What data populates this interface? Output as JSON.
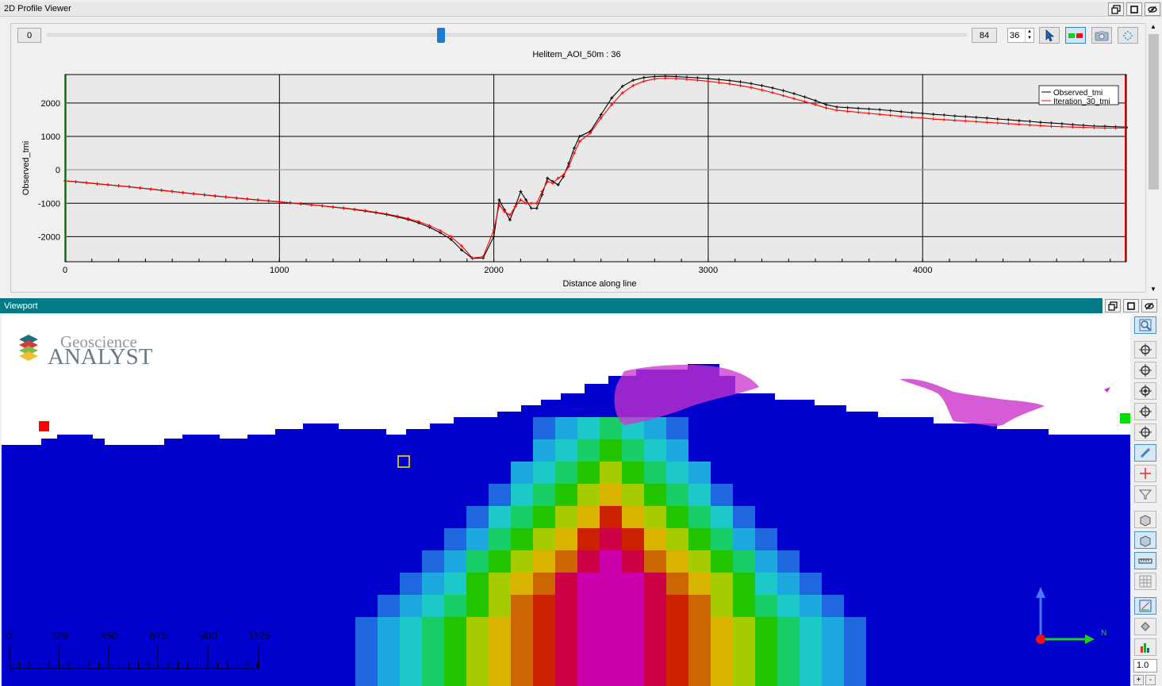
{
  "profile_viewer": {
    "title": "2D Profile Viewer",
    "slider": {
      "min_label": "0",
      "max_label": "84",
      "position": 0.4286
    },
    "station_value": "36",
    "tools": [
      "select-arrow-icon",
      "color-legend-icon",
      "camera-icon",
      "scatter-icon"
    ]
  },
  "chart_data": {
    "type": "line",
    "title": "Helitem_AOI_50m : 36",
    "xlabel": "Distance along line",
    "ylabel": "Observed_tmi",
    "xlim": [
      0,
      4950
    ],
    "ylim": [
      -2750,
      2850
    ],
    "xticks": [
      0,
      1000,
      2000,
      3000,
      4000
    ],
    "yticks": [
      -2000,
      -1000,
      0,
      1000,
      2000
    ],
    "x_grid_lines": [
      1000,
      2000,
      3000,
      4000
    ],
    "y_grid_lines": [
      -2000,
      -1000,
      0,
      1000,
      2000
    ],
    "legend_position": "top-right",
    "series": [
      {
        "name": "Observed_tmi",
        "color": "#000000",
        "marker": "+",
        "x": [
          0,
          50,
          100,
          150,
          200,
          250,
          300,
          350,
          400,
          450,
          500,
          550,
          600,
          650,
          700,
          750,
          800,
          850,
          900,
          950,
          1000,
          1050,
          1100,
          1150,
          1200,
          1250,
          1300,
          1350,
          1400,
          1450,
          1500,
          1550,
          1600,
          1650,
          1700,
          1750,
          1800,
          1850,
          1900,
          1950,
          2000,
          2025,
          2050,
          2075,
          2100,
          2125,
          2150,
          2175,
          2200,
          2225,
          2250,
          2275,
          2300,
          2325,
          2350,
          2375,
          2400,
          2450,
          2500,
          2550,
          2600,
          2650,
          2700,
          2750,
          2800,
          2850,
          2900,
          2950,
          3000,
          3050,
          3100,
          3150,
          3200,
          3250,
          3300,
          3350,
          3400,
          3450,
          3500,
          3550,
          3600,
          3650,
          3700,
          3750,
          3800,
          3850,
          3900,
          3950,
          4000,
          4050,
          4100,
          4150,
          4200,
          4250,
          4300,
          4350,
          4400,
          4450,
          4500,
          4550,
          4600,
          4650,
          4700,
          4750,
          4800,
          4850,
          4900,
          4950
        ],
        "y": [
          -330,
          -360,
          -390,
          -420,
          -450,
          -480,
          -510,
          -545,
          -580,
          -615,
          -650,
          -685,
          -720,
          -750,
          -785,
          -815,
          -845,
          -875,
          -905,
          -935,
          -960,
          -990,
          -1020,
          -1050,
          -1080,
          -1115,
          -1150,
          -1190,
          -1235,
          -1285,
          -1340,
          -1410,
          -1490,
          -1590,
          -1720,
          -1880,
          -2080,
          -2400,
          -2650,
          -2640,
          -2000,
          -900,
          -1200,
          -1500,
          -1100,
          -650,
          -900,
          -1150,
          -1150,
          -750,
          -250,
          -350,
          -450,
          -200,
          200,
          650,
          1000,
          1150,
          1650,
          2150,
          2500,
          2680,
          2760,
          2790,
          2800,
          2790,
          2770,
          2750,
          2730,
          2700,
          2670,
          2630,
          2580,
          2520,
          2450,
          2370,
          2280,
          2180,
          2070,
          1950,
          1880,
          1860,
          1840,
          1820,
          1800,
          1770,
          1740,
          1710,
          1690,
          1660,
          1640,
          1610,
          1590,
          1570,
          1550,
          1520,
          1500,
          1470,
          1450,
          1420,
          1400,
          1380,
          1350,
          1330,
          1310,
          1300,
          1290,
          1280
        ]
      },
      {
        "name": "Iteration_30_tmi",
        "color": "#ff0000",
        "marker": "+",
        "x": [
          0,
          50,
          100,
          150,
          200,
          250,
          300,
          350,
          400,
          450,
          500,
          550,
          600,
          650,
          700,
          750,
          800,
          850,
          900,
          950,
          1000,
          1050,
          1100,
          1150,
          1200,
          1250,
          1300,
          1350,
          1400,
          1450,
          1500,
          1550,
          1600,
          1650,
          1700,
          1750,
          1800,
          1850,
          1900,
          1950,
          2000,
          2025,
          2050,
          2075,
          2100,
          2125,
          2150,
          2175,
          2200,
          2225,
          2250,
          2275,
          2300,
          2325,
          2350,
          2375,
          2400,
          2450,
          2500,
          2550,
          2600,
          2650,
          2700,
          2750,
          2800,
          2850,
          2900,
          2950,
          3000,
          3050,
          3100,
          3150,
          3200,
          3250,
          3300,
          3350,
          3400,
          3450,
          3500,
          3550,
          3600,
          3650,
          3700,
          3750,
          3800,
          3850,
          3900,
          3950,
          4000,
          4050,
          4100,
          4150,
          4200,
          4250,
          4300,
          4350,
          4400,
          4450,
          4500,
          4550,
          4600,
          4650,
          4700,
          4750,
          4800,
          4850,
          4900,
          4950
        ],
        "y": [
          -330,
          -355,
          -385,
          -415,
          -445,
          -475,
          -505,
          -540,
          -575,
          -610,
          -645,
          -680,
          -715,
          -745,
          -780,
          -810,
          -840,
          -870,
          -900,
          -930,
          -955,
          -985,
          -1015,
          -1045,
          -1075,
          -1110,
          -1140,
          -1180,
          -1220,
          -1270,
          -1320,
          -1385,
          -1460,
          -1550,
          -1670,
          -1820,
          -2000,
          -2280,
          -2640,
          -2600,
          -1800,
          -1050,
          -1250,
          -1350,
          -1100,
          -900,
          -1000,
          -1000,
          -1000,
          -650,
          -350,
          -400,
          -250,
          -150,
          100,
          500,
          850,
          1100,
          1550,
          1950,
          2300,
          2520,
          2650,
          2720,
          2740,
          2730,
          2710,
          2680,
          2650,
          2610,
          2570,
          2520,
          2460,
          2390,
          2310,
          2220,
          2130,
          2040,
          1950,
          1850,
          1780,
          1750,
          1720,
          1690,
          1660,
          1630,
          1600,
          1570,
          1550,
          1520,
          1500,
          1480,
          1460,
          1440,
          1420,
          1400,
          1380,
          1360,
          1340,
          1320,
          1300,
          1290,
          1280,
          1270,
          1260,
          1250,
          1250,
          1250
        ]
      }
    ]
  },
  "viewport": {
    "title": "Viewport",
    "logo": {
      "top_text": "Geoscience",
      "bottom_text": "ANALYST"
    },
    "scale_bar": {
      "labels": [
        "0",
        "225",
        "450",
        "675",
        "900",
        "1125"
      ]
    },
    "north_label": "N",
    "zoom_value": "1.0",
    "plus_label": "+",
    "minus_label": "-"
  }
}
